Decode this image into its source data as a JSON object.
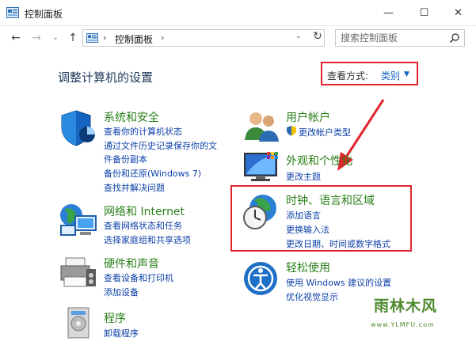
{
  "window": {
    "title": "控制面板",
    "controls": {
      "minimize": "—",
      "maximize": "☐",
      "close": "✕"
    }
  },
  "addressbar": {
    "back_icon": "←",
    "forward_icon": "→",
    "recent_icon": "⌄",
    "up_icon": "↑",
    "crumb_sep": "›",
    "crumb": "控制面板",
    "crumb_sep2": "›",
    "dropdown": "⌄",
    "refresh_icon": "↻",
    "search_placeholder": "搜索控制面板"
  },
  "main": {
    "heading": "调整计算机的设置",
    "view_by_label": "查看方式:",
    "view_by_value": "类别",
    "view_by_arrow": "▼"
  },
  "categories_left": [
    {
      "title": "系统和安全",
      "links": [
        "查看你的计算机状态",
        "通过文件历史记录保存你的文",
        "件备份副本",
        "备份和还原(Windows 7)",
        "查找并解决问题"
      ]
    },
    {
      "title": "网络和 Internet",
      "links": [
        "查看网络状态和任务",
        "选择家庭组和共享选项"
      ]
    },
    {
      "title": "硬件和声音",
      "links": [
        "查看设备和打印机",
        "添加设备"
      ]
    },
    {
      "title": "程序",
      "links": [
        "卸载程序"
      ]
    }
  ],
  "categories_right": [
    {
      "title": "用户帐户",
      "links": [
        "更改帐户类型"
      ]
    },
    {
      "title": "外观和个性化",
      "links": [
        "更改主题"
      ]
    },
    {
      "title": "时钟、语言和区域",
      "links": [
        "添加语言",
        "更换输入法",
        "更改日期、时间或数字格式"
      ]
    },
    {
      "title": "轻松使用",
      "links": [
        "使用 Windows 建议的设置",
        "优化视觉显示"
      ]
    }
  ],
  "watermark": {
    "main": "雨林木风",
    "url": "www.YLMFU.com"
  },
  "colors": {
    "accent_red": "#e0242b",
    "link_blue": "#0b3fa8",
    "category_green": "#2a7f1a"
  }
}
